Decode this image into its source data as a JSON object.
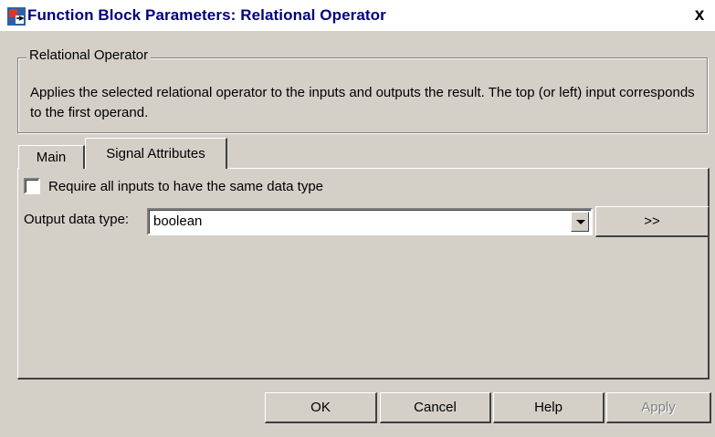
{
  "window": {
    "title": "Function Block Parameters: Relational Operator",
    "close_label": "x"
  },
  "group": {
    "legend": "Relational Operator",
    "description": "Applies the selected relational operator to the inputs and outputs the result. The top (or left) input corresponds to the first operand."
  },
  "tabs": [
    {
      "label": "Main",
      "active": false
    },
    {
      "label": "Signal Attributes",
      "active": true
    }
  ],
  "signal_attributes": {
    "require_same_type_label": "Require all inputs to have the same data type",
    "require_same_type_checked": false,
    "output_data_type_label": "Output data type:",
    "output_data_type_value": "boolean",
    "more_button_label": ">>"
  },
  "buttons": {
    "ok": "OK",
    "cancel": "Cancel",
    "help": "Help",
    "apply": "Apply"
  },
  "colors": {
    "face": "#d4d0c8",
    "title_text": "#000080",
    "disabled_text": "#808080"
  },
  "icons": {
    "window_icon": "simulink-block-icon",
    "close": "close-icon",
    "dropdown": "chevron-down-icon"
  }
}
